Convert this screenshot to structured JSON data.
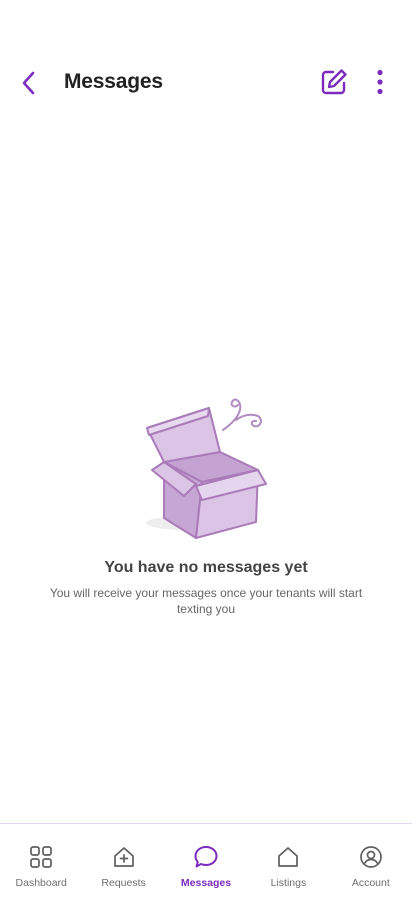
{
  "header": {
    "title": "Messages",
    "back_icon": "chevron-left-icon",
    "compose_icon": "edit-icon",
    "more_icon": "more-vertical-icon"
  },
  "empty_state": {
    "illustration": "open-box-illustration",
    "title": "You have no messages yet",
    "subtitle": "You will receive your messages once your tenants will start texting you"
  },
  "nav": {
    "items": [
      {
        "label": "Dashboard",
        "icon": "grid-icon",
        "active": false
      },
      {
        "label": "Requests",
        "icon": "house-plus-icon",
        "active": false
      },
      {
        "label": "Messages",
        "icon": "chat-bubble-icon",
        "active": true
      },
      {
        "label": "Listings",
        "icon": "home-icon",
        "active": false
      },
      {
        "label": "Account",
        "icon": "user-circle-icon",
        "active": false
      }
    ]
  },
  "colors": {
    "accent": "#7b2cbf",
    "box_fill": "#d8bfe0",
    "box_stroke": "#a97bb8",
    "nav_inactive": "#6f6f6f"
  }
}
